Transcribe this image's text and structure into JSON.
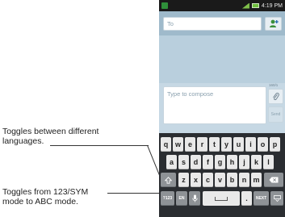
{
  "callouts": {
    "languages": "Toggles between different languages.",
    "symbols": "Toggles from 123/SYM mode to ABC mode."
  },
  "status_bar": {
    "time": "4:19 PM",
    "icons": [
      "notification-icon",
      "signal-icon",
      "battery-icon"
    ]
  },
  "compose": {
    "to_placeholder": "To",
    "message_placeholder": "Type to compose",
    "char_counter": "160/1",
    "send_label": "Send",
    "contact_icon": "contact-add-icon",
    "attach_icon": "paperclip-icon"
  },
  "keyboard": {
    "row1": [
      "q",
      "w",
      "e",
      "r",
      "t",
      "y",
      "u",
      "i",
      "o",
      "p"
    ],
    "row2": [
      "a",
      "s",
      "d",
      "f",
      "g",
      "h",
      "j",
      "k",
      "l"
    ],
    "row3": [
      "z",
      "x",
      "c",
      "v",
      "b",
      "n",
      "m"
    ],
    "sym_label": "?123",
    "lang_label": "EN",
    "next_label": "NEXT",
    "period_label": ".",
    "shift_icon": "shift-icon",
    "mic_icon": "microphone-icon",
    "backspace_icon": "backspace-icon",
    "hide_icon": "keyboard-hide-icon"
  },
  "colors": {
    "screen_bg": "#b9cfdd",
    "keyboard_bg": "#2a2d31",
    "key_light": "#e9e9e9",
    "key_dark": "#8e9296"
  }
}
